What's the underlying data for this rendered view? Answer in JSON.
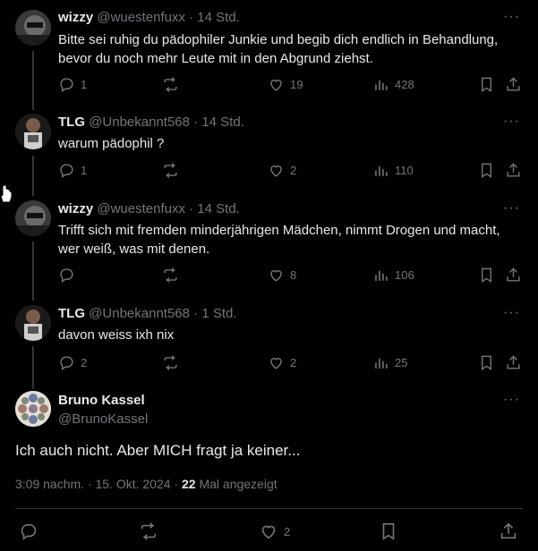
{
  "tweets": [
    {
      "name": "wizzy",
      "handle": "@wuestenfuxx",
      "time": "· 14 Std.",
      "text": "Bitte sei ruhig du pädophiler Junkie und begib dich endlich in Behandlung, bevor du noch mehr Leute mit in den Abgrund ziehst.",
      "replies": "1",
      "reposts": "",
      "likes": "19",
      "views": "428"
    },
    {
      "name": "TLG",
      "handle": "@Unbekannt568",
      "time": "· 14 Std.",
      "text": "warum pädophil ?",
      "replies": "1",
      "reposts": "",
      "likes": "2",
      "views": "110"
    },
    {
      "name": "wizzy",
      "handle": "@wuestenfuxx",
      "time": "· 14 Std.",
      "text": "Trifft sich mit fremden minderjährigen Mädchen, nimmt Drogen und macht, wer weiß, was mit denen.",
      "replies": "",
      "reposts": "",
      "likes": "8",
      "views": "106"
    },
    {
      "name": "TLG",
      "handle": "@Unbekannt568",
      "time": "· 1 Std.",
      "text": "davon weiss ixh nix",
      "replies": "2",
      "reposts": "",
      "likes": "2",
      "views": "25"
    }
  ],
  "focus": {
    "name": "Bruno Kassel",
    "handle": "@BrunoKassel",
    "text": "Ich auch nicht. Aber MICH fragt ja keiner...",
    "timestamp": "3:09 nachm. · 15. Okt. 2024 ·",
    "views_count": "22",
    "views_label": "Mal angezeigt",
    "likes": "2"
  },
  "more_label": "···",
  "icons": [
    "reply-icon",
    "repost-icon",
    "like-icon",
    "views-icon",
    "bookmark-icon",
    "share-icon",
    "more-icon",
    "cursor-icon"
  ],
  "colors": {
    "background": "#000000",
    "text": "#e7e9ea",
    "muted": "#71767b",
    "divider": "#2f3336"
  }
}
